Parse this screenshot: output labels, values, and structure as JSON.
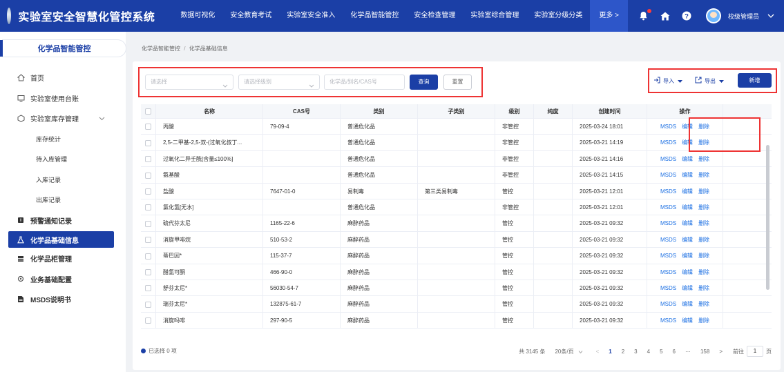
{
  "app": {
    "title": "实验室安全智慧化管控系统"
  },
  "nav": [
    "数据可视化",
    "安全教育考试",
    "实验室安全准入",
    "化学品智能管控",
    "安全检查管理",
    "实验室综合管理",
    "实验室分级分类"
  ],
  "nav_more": "更多 >",
  "user": {
    "name": "校级管理员"
  },
  "sidebar": {
    "header": "化学品智能管控",
    "items": [
      {
        "label": "首页",
        "icon": "home-icon"
      },
      {
        "label": "实验室使用台账",
        "icon": "monitor-icon"
      },
      {
        "label": "实验室库存管理",
        "icon": "box-icon"
      }
    ],
    "sub_items": [
      "库存统计",
      "待入库管理",
      "入库记录",
      "出库记录"
    ],
    "items2": [
      {
        "label": "预警通知记录",
        "icon": "alert-icon"
      },
      {
        "label": "化学品基础信息",
        "icon": "flask-icon"
      },
      {
        "label": "化学品柜管理",
        "icon": "cabinet-icon"
      },
      {
        "label": "业务基础配置",
        "icon": "gear-icon"
      },
      {
        "label": "MSDS说明书",
        "icon": "document-icon"
      }
    ]
  },
  "breadcrumb": {
    "parent": "化学品智能管控",
    "sep": "/",
    "current": "化学品基础信息"
  },
  "filters": {
    "select1_placeholder": "请选择",
    "select2_placeholder": "请选择级别",
    "search_placeholder": "化学品/别名/CAS号",
    "query_label": "查询",
    "reset_label": "重置"
  },
  "actions": {
    "import_label": "导入",
    "export_label": "导出",
    "add_label": "新增"
  },
  "table": {
    "columns": [
      "名称",
      "CAS号",
      "类别",
      "子类别",
      "级别",
      "纯度",
      "创建时间",
      "操作"
    ],
    "op_labels": [
      "MSDS",
      "编辑",
      "删除"
    ],
    "rows": [
      {
        "name": "丙酸",
        "cas": "79-09-4",
        "category": "普通危化品",
        "subcategory": "",
        "level": "非管控",
        "purity": "",
        "created": "2025-03-24 18:01"
      },
      {
        "name": "2,5-二甲基-2,5-双-(过氧化叔丁...",
        "cas": "",
        "category": "普通危化品",
        "subcategory": "",
        "level": "非管控",
        "purity": "",
        "created": "2025-03-21 14:19"
      },
      {
        "name": "过氧化二异壬酰[含量≤100%]",
        "cas": "",
        "category": "普通危化品",
        "subcategory": "",
        "level": "非管控",
        "purity": "",
        "created": "2025-03-21 14:16"
      },
      {
        "name": "氨基酸",
        "cas": "",
        "category": "普通危化品",
        "subcategory": "",
        "level": "非管控",
        "purity": "",
        "created": "2025-03-21 14:15"
      },
      {
        "name": "盐酸",
        "cas": "7647-01-0",
        "category": "易制毒",
        "subcategory": "第三类易制毒",
        "level": "管控",
        "purity": "",
        "created": "2025-03-21 12:01"
      },
      {
        "name": "氯化氢[无水]",
        "cas": "",
        "category": "普通危化品",
        "subcategory": "",
        "level": "非管控",
        "purity": "",
        "created": "2025-03-21 12:01"
      },
      {
        "name": "硫代芬太尼",
        "cas": "1165-22-6",
        "category": "麻醉药品",
        "subcategory": "",
        "level": "管控",
        "purity": "",
        "created": "2025-03-21 09:32"
      },
      {
        "name": "消旋甲啡烷",
        "cas": "510-53-2",
        "category": "麻醉药品",
        "subcategory": "",
        "level": "管控",
        "purity": "",
        "created": "2025-03-21 09:32"
      },
      {
        "name": "蒂巴因*",
        "cas": "115-37-7",
        "category": "麻醉药品",
        "subcategory": "",
        "level": "管控",
        "purity": "",
        "created": "2025-03-21 09:32"
      },
      {
        "name": "醋氢可酮",
        "cas": "466-90-0",
        "category": "麻醉药品",
        "subcategory": "",
        "level": "管控",
        "purity": "",
        "created": "2025-03-21 09:32"
      },
      {
        "name": "舒芬太尼*",
        "cas": "56030-54-7",
        "category": "麻醉药品",
        "subcategory": "",
        "level": "管控",
        "purity": "",
        "created": "2025-03-21 09:32"
      },
      {
        "name": "瑞芬太尼*",
        "cas": "132875-61-7",
        "category": "麻醉药品",
        "subcategory": "",
        "level": "管控",
        "purity": "",
        "created": "2025-03-21 09:32"
      },
      {
        "name": "消旋吗啡",
        "cas": "297-90-5",
        "category": "麻醉药品",
        "subcategory": "",
        "level": "管控",
        "purity": "",
        "created": "2025-03-21 09:32"
      }
    ]
  },
  "footer": {
    "selected": "已选择 0 项",
    "total": "共 3145 条",
    "page_size": "20条/页",
    "pages": [
      "1",
      "2",
      "3",
      "4",
      "5",
      "6"
    ],
    "ellipsis": "···",
    "last_page": "158",
    "goto_label": "前往",
    "goto_value": "1",
    "page_unit": "页"
  },
  "colors": {
    "primary": "#1b3fa6",
    "highlight": "#e33333",
    "link": "#1b6fe3"
  }
}
